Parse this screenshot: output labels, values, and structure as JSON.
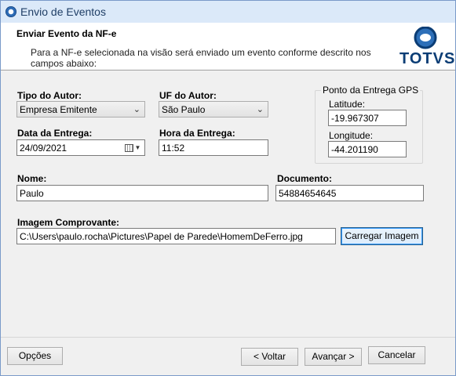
{
  "window": {
    "title": "Envio de Eventos"
  },
  "header": {
    "title": "Enviar Evento da NF-e",
    "description": "Para a NF-e selecionada na visão será enviado um evento conforme descrito nos campos abaixo:",
    "logo_text": "TOTVS"
  },
  "form": {
    "tipo_autor": {
      "label": "Tipo do Autor:",
      "value": "Empresa Emitente"
    },
    "uf_autor": {
      "label": "UF do Autor:",
      "value": "São Paulo"
    },
    "data_entrega": {
      "label": "Data da Entrega:",
      "value": "24/09/2021"
    },
    "hora_entrega": {
      "label": "Hora da Entrega:",
      "value": "11:52"
    },
    "gps": {
      "title": "Ponto da Entrega GPS",
      "latitude_label": "Latitude:",
      "latitude": "-19.967307",
      "longitude_label": "Longitude:",
      "longitude": "-44.201190"
    },
    "nome": {
      "label": "Nome:",
      "value": "Paulo"
    },
    "documento": {
      "label": "Documento:",
      "value": "54884654645"
    },
    "imagem": {
      "label": "Imagem Comprovante:",
      "value": "C:\\Users\\paulo.rocha\\Pictures\\Papel de Parede\\HomemDeFerro.jpg"
    },
    "carregar_label": "Carregar Imagem"
  },
  "footer": {
    "opcoes": "Opções",
    "voltar": "< Voltar",
    "avancar": "Avançar >",
    "cancelar": "Cancelar"
  },
  "icons": {
    "dropdown": "chevron-down-icon",
    "calendar": "calendar-icon",
    "app": "totvs-app-icon"
  }
}
